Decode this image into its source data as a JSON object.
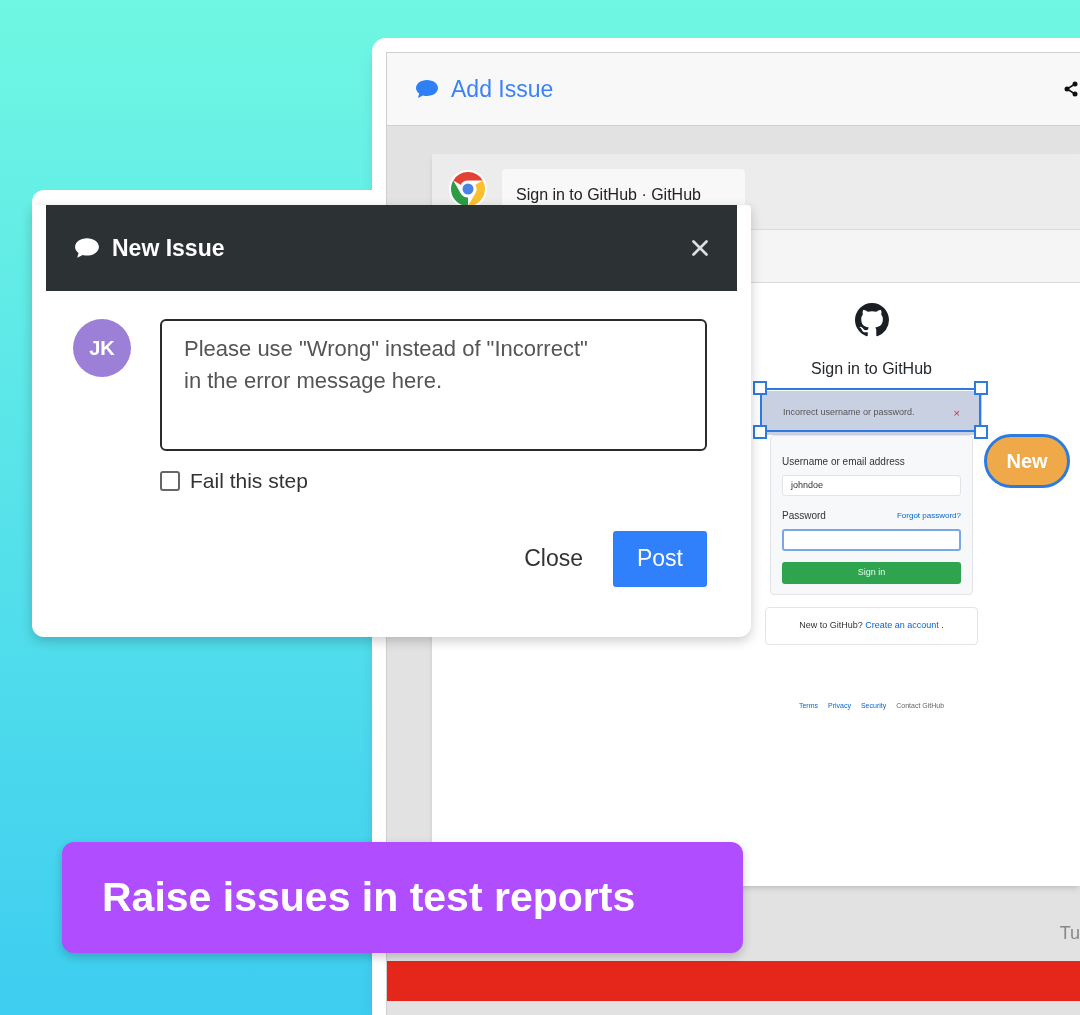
{
  "app_header": {
    "title": "Add Issue"
  },
  "browser": {
    "tab_title": "Sign in to GitHub · GitHub"
  },
  "github_page": {
    "heading": "Sign in to GitHub",
    "error": "Incorrect username or password.",
    "error_close": "×",
    "username_label": "Username or email address",
    "username_value": "johndoe",
    "password_label": "Password",
    "forgot_link": "Forgot password?",
    "sign_in_button": "Sign in",
    "new_prompt": "New to GitHub?",
    "create_link": "Create an account",
    "create_suffix": ".",
    "footer_links": [
      {
        "label": "Terms",
        "kind": "link"
      },
      {
        "label": "Privacy",
        "kind": "link"
      },
      {
        "label": "Security",
        "kind": "link"
      },
      {
        "label": "Contact GitHub",
        "kind": "text"
      }
    ]
  },
  "annotation": {
    "badge": "New"
  },
  "cut_text": "Tu",
  "dialog": {
    "title": "New Issue",
    "avatar": "JK",
    "comment": "Please use \"Wrong\" instead of \"Incorrect\" in the error message here.",
    "fail_step": {
      "label": "Fail this step",
      "checked": false
    },
    "buttons": [
      {
        "label": "Close",
        "kind": "secondary"
      },
      {
        "label": "Post",
        "kind": "primary"
      }
    ]
  },
  "banner": "Raise issues in test reports"
}
